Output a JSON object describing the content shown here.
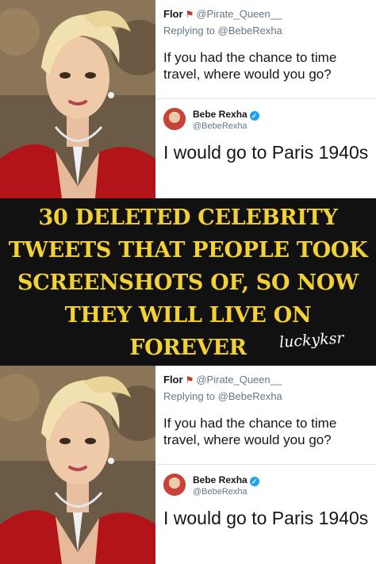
{
  "headline": "30 DELETED CELEBRITY TWEETS THAT PEOPLE TOOK SCREENSHOTS OF, SO NOW THEY WILL LIVE ON FOREVER",
  "signature": "luckyksr",
  "tweet": {
    "reply_name": "Flor",
    "reply_handle": "@Pirate_Queen__",
    "replying_to": "Replying to @BebeRexha",
    "question": "If you had the chance to time travel, where would you go?",
    "answer_name": "Bebe Rexha",
    "answer_handle": "@BebeRexha",
    "answer": "I would go to Paris 1940s"
  },
  "icons": {
    "reply_icon": "skull-flag-icon",
    "verified_icon": "verified-badge-icon"
  },
  "colors": {
    "banner": "#111111",
    "headline": "#f2d135",
    "dress": "#b3141a",
    "verified": "#1da1f2"
  }
}
